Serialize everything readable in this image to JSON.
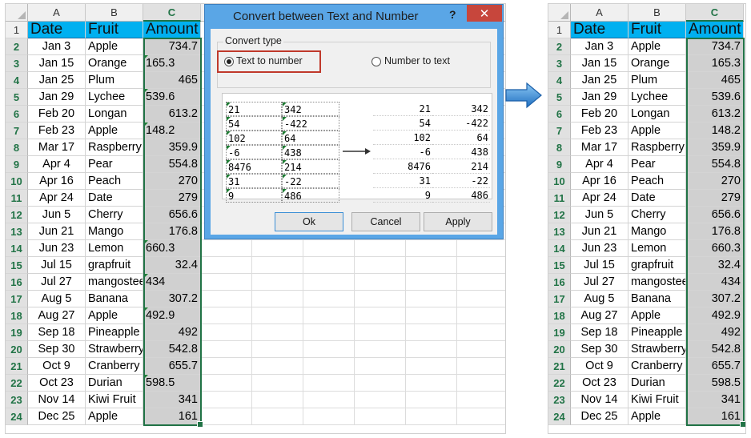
{
  "sheet": {
    "columns": [
      "A",
      "B",
      "C"
    ],
    "header": {
      "date": "Date",
      "fruit": "Fruit",
      "amount": "Amount"
    },
    "rows": [
      {
        "date": "Jan 3",
        "fruit": "Apple",
        "amount": "734.7",
        "text": false
      },
      {
        "date": "Jan 15",
        "fruit": "Orange",
        "amount": "165.3",
        "text": true
      },
      {
        "date": "Jan 25",
        "fruit": "Plum",
        "amount": "465",
        "text": false
      },
      {
        "date": "Jan 29",
        "fruit": "Lychee",
        "amount": "539.6",
        "text": true
      },
      {
        "date": "Feb 20",
        "fruit": "Longan",
        "amount": "613.2",
        "text": false
      },
      {
        "date": "Feb 23",
        "fruit": "Apple",
        "amount": "148.2",
        "text": true
      },
      {
        "date": "Mar 17",
        "fruit": "Raspberry",
        "amount": "359.9",
        "text": false
      },
      {
        "date": "Apr 4",
        "fruit": "Pear",
        "amount": "554.8",
        "text": false
      },
      {
        "date": "Apr 16",
        "fruit": "Peach",
        "amount": "270",
        "text": false
      },
      {
        "date": "Apr 24",
        "fruit": "Date",
        "amount": "279",
        "text": false
      },
      {
        "date": "Jun 5",
        "fruit": "Cherry",
        "amount": "656.6",
        "text": false
      },
      {
        "date": "Jun 21",
        "fruit": "Mango",
        "amount": "176.8",
        "text": false
      },
      {
        "date": "Jun 23",
        "fruit": "Lemon",
        "amount": "660.3",
        "text": true
      },
      {
        "date": "Jul 15",
        "fruit": "grapfruit",
        "amount": "32.4",
        "text": false
      },
      {
        "date": "Jul 27",
        "fruit": "mangosteen",
        "amount": "434",
        "text": true
      },
      {
        "date": "Aug 5",
        "fruit": "Banana",
        "amount": "307.2",
        "text": false
      },
      {
        "date": "Aug 27",
        "fruit": "Apple",
        "amount": "492.9",
        "text": true
      },
      {
        "date": "Sep 18",
        "fruit": "Pineapple",
        "amount": "492",
        "text": false
      },
      {
        "date": "Sep 30",
        "fruit": "Strawberry",
        "amount": "542.8",
        "text": false
      },
      {
        "date": "Oct 9",
        "fruit": "Cranberry",
        "amount": "655.7",
        "text": false
      },
      {
        "date": "Oct 23",
        "fruit": "Durian",
        "amount": "598.5",
        "text": true
      },
      {
        "date": "Nov 14",
        "fruit": "Kiwi Fruit",
        "amount": "341",
        "text": false
      },
      {
        "date": "Dec 25",
        "fruit": "Apple",
        "amount": "161",
        "text": false
      }
    ]
  },
  "dialog": {
    "title": "Convert between Text and Number",
    "help": "?",
    "close": "✕",
    "group_label": "Convert type",
    "option_text_to_number": "Text to number",
    "option_number_to_text": "Number to text",
    "selected_option": "text_to_number",
    "preview_source": [
      [
        "21",
        "342"
      ],
      [
        "54",
        "-422"
      ],
      [
        "102",
        "64"
      ],
      [
        "-6",
        "438"
      ],
      [
        "8476",
        "214"
      ],
      [
        "31",
        "-22"
      ],
      [
        "9",
        "486"
      ]
    ],
    "preview_result": [
      [
        "21",
        "342"
      ],
      [
        "54",
        "-422"
      ],
      [
        "102",
        "64"
      ],
      [
        "-6",
        "438"
      ],
      [
        "8476",
        "214"
      ],
      [
        "31",
        "-22"
      ],
      [
        "9",
        "486"
      ]
    ],
    "buttons": {
      "ok": "Ok",
      "cancel": "Cancel",
      "apply": "Apply"
    }
  },
  "colors": {
    "header_fill": "#00b0f0",
    "amount_fill": "#d0d0d0",
    "selection": "#217346",
    "text_flag": "#1e7e34",
    "arrow": "#2f86d2"
  },
  "icons": {
    "arrow": "right-arrow-icon",
    "close": "close-icon",
    "help": "help-icon"
  }
}
